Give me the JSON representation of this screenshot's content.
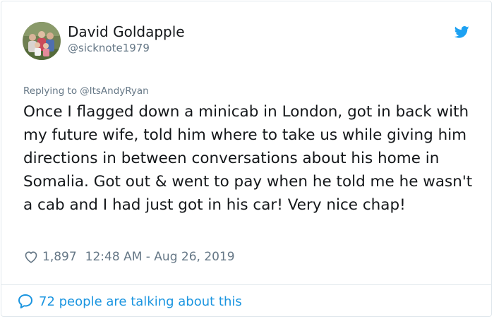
{
  "author": {
    "display_name": "David Goldapple",
    "handle": "@sicknote1979",
    "avatar_icon": "family-photo-avatar"
  },
  "brand_icon": "twitter-bird-icon",
  "reply": {
    "prefix": "Replying to",
    "to": "@ItsAndyRyan"
  },
  "tweet": {
    "text": "Once I flagged down a minicab in London, got in back with my future wife, told him where to take us while giving him directions in between conversations about his home in Somalia. Got out & went to pay when he told me he wasn't a cab and I had just got in his car! Very nice chap!"
  },
  "meta": {
    "like_count": "1,897",
    "timestamp": "12:48 AM - Aug 26, 2019"
  },
  "footer": {
    "talking_label": "72 people are talking about this"
  },
  "colors": {
    "brand_blue": "#1da1f2",
    "link_blue": "#1b95e0",
    "secondary_text": "#657786",
    "primary_text": "#14171a",
    "border": "#e1e8ed"
  }
}
